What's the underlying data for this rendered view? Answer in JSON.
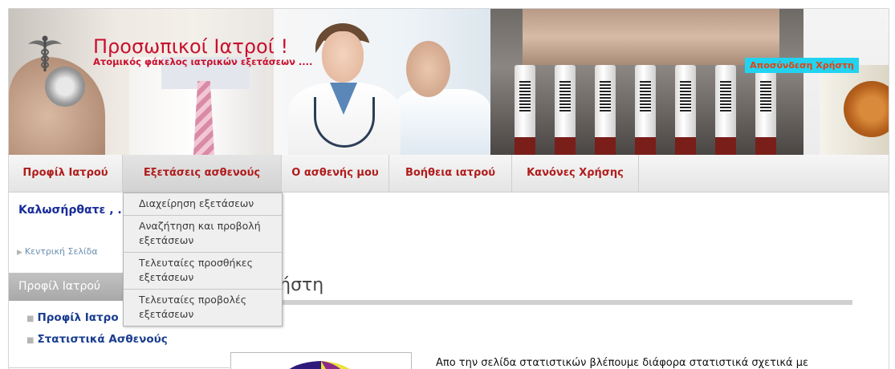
{
  "header": {
    "title": "Προσωπικοί Ιατροί !",
    "subtitle": "Ατομικός φάκελος ιατρικών εξετάσεων ....",
    "logout_label": "Αποσύνδεση Χρήστη",
    "logo_icon": "caduceus-icon"
  },
  "nav": {
    "items": [
      {
        "label": "Προφίλ Ιατρού"
      },
      {
        "label": "Εξετάσεις ασθενούς"
      },
      {
        "label": "Ο ασθενής μου"
      },
      {
        "label": "Βοήθεια ιατρού"
      },
      {
        "label": "Κανόνες Χρήσης"
      }
    ],
    "active_index": 1
  },
  "dropdown": {
    "items": [
      {
        "label": "Διαχείρηση εξετάσεων"
      },
      {
        "label": "Αναζήτηση και προβολή εξετάσεων"
      },
      {
        "label": "Τελευταίες προσθήκες εξετάσεων"
      },
      {
        "label": "Τελευταίες προβολές εξετάσεων"
      }
    ]
  },
  "content": {
    "welcome": "Καλωσήρθατε , .",
    "breadcrumb": "Κεντρική Σελίδα",
    "sidebar_heading": "Προφίλ Ιατρού",
    "sidebar_links": [
      {
        "label": "Προφίλ Ιατρο"
      },
      {
        "label": "Στατιστικά Ασθενούς"
      }
    ],
    "page_heading": "στικά Χρήστη",
    "paragraph": "Απο την σελίδα στατιστικών βλέπουμε διάφορα στατιστικά σχετικά με"
  },
  "colors": {
    "brand_red": "#c8102e",
    "logout_bg": "#22d3f1",
    "nav_text": "#b01c1c",
    "link_blue": "#1a3d8f"
  }
}
